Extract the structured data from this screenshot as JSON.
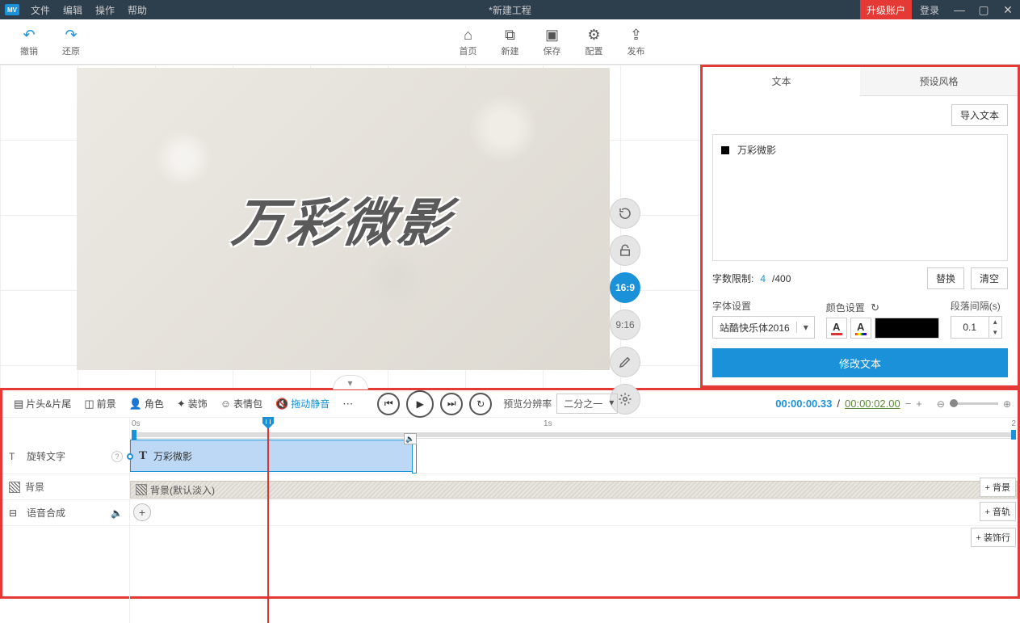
{
  "menubar": {
    "logo": "MV",
    "items": [
      "文件",
      "编辑",
      "操作",
      "帮助"
    ],
    "title": "*新建工程",
    "upgrade": "升级账户",
    "login": "登录"
  },
  "toolbar": {
    "undo": "撤销",
    "redo": "还原",
    "home": "首页",
    "new": "新建",
    "save": "保存",
    "config": "配置",
    "publish": "发布"
  },
  "canvas": {
    "text": "万彩微影",
    "ratios": {
      "r1": "16:9",
      "r2": "9:16"
    }
  },
  "panel": {
    "tab_text": "文本",
    "tab_style": "预设风格",
    "import": "导入文本",
    "item_text": "万彩微影",
    "limit_label": "字数限制:",
    "limit_count": "4",
    "limit_total": "/400",
    "replace": "替换",
    "clear": "清空",
    "font_label": "字体设置",
    "font_value": "站酷快乐体2016",
    "color_label": "颜色设置",
    "para_label": "段落间隔(s)",
    "para_value": "0.1",
    "apply": "修改文本"
  },
  "tl": {
    "tools": {
      "headtail": "片头&片尾",
      "foreground": "前景",
      "role": "角色",
      "decor": "装饰",
      "emoji": "表情包",
      "drag_mute": "拖动静音"
    },
    "res_label": "预览分辨率",
    "res_value": "二分之一",
    "cur_time": "00:00:00.33",
    "total_time": "00:00:02.00",
    "ruler": {
      "t0": "0s",
      "t1": "1s",
      "t2": "2"
    },
    "tracks": {
      "rotate_text": "旋转文字",
      "rotate_clip_text": "万彩微影",
      "bg": "背景",
      "bg_clip": "背景(默认淡入)",
      "voice": "语音合成",
      "add_bg": "+ 背景",
      "add_audio": "+ 音轨",
      "add_decor": "+ 装饰行"
    }
  }
}
